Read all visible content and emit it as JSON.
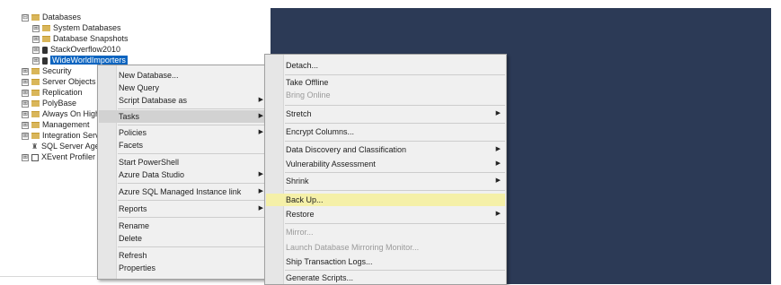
{
  "tree": {
    "items": [
      {
        "label": "Databases",
        "expander": "⊟",
        "icon": "folder"
      },
      {
        "label": "System Databases",
        "expander": "⊞",
        "icon": "folder"
      },
      {
        "label": "Database Snapshots",
        "expander": "⊞",
        "icon": "folder"
      },
      {
        "label": "StackOverflow2010",
        "expander": "⊞",
        "icon": "db"
      },
      {
        "label": "WideWorldImporters",
        "expander": "⊞",
        "icon": "db"
      },
      {
        "label": "Security",
        "expander": "⊞",
        "icon": "folder"
      },
      {
        "label": "Server Objects",
        "expander": "⊞",
        "icon": "folder"
      },
      {
        "label": "Replication",
        "expander": "⊞",
        "icon": "folder"
      },
      {
        "label": "PolyBase",
        "expander": "⊞",
        "icon": "folder"
      },
      {
        "label": "Always On High Availability",
        "expander": "⊞",
        "icon": "folder"
      },
      {
        "label": "Management",
        "expander": "⊞",
        "icon": "folder"
      },
      {
        "label": "Integration Services Catalogs",
        "expander": "⊞",
        "icon": "folder"
      },
      {
        "label": "SQL Server Agent",
        "expander": "",
        "icon": "agent"
      },
      {
        "label": "XEvent Profiler",
        "expander": "⊞",
        "icon": "xevent"
      }
    ]
  },
  "context_menu": {
    "items": [
      {
        "label": "New Database..."
      },
      {
        "label": "New Query"
      },
      {
        "label": "Script Database as",
        "arrow": "▶"
      },
      {
        "label": "Tasks",
        "arrow": "▶"
      },
      {
        "label": "Policies",
        "arrow": "▶"
      },
      {
        "label": "Facets"
      },
      {
        "label": "Start PowerShell"
      },
      {
        "label": "Azure Data Studio",
        "arrow": "▶"
      },
      {
        "label": "Azure SQL Managed Instance link",
        "arrow": "▶"
      },
      {
        "label": "Reports",
        "arrow": "▶"
      },
      {
        "label": "Rename"
      },
      {
        "label": "Delete"
      },
      {
        "label": "Refresh"
      },
      {
        "label": "Properties"
      }
    ]
  },
  "tasks_menu": {
    "items": [
      {
        "label": "Detach..."
      },
      {
        "label": "Take Offline"
      },
      {
        "label": "Bring Online"
      },
      {
        "label": "Stretch",
        "arrow": "▶"
      },
      {
        "label": "Encrypt Columns..."
      },
      {
        "label": "Data Discovery and Classification",
        "arrow": "▶"
      },
      {
        "label": "Vulnerability Assessment",
        "arrow": "▶"
      },
      {
        "label": "Shrink",
        "arrow": "▶"
      },
      {
        "label": "Back Up..."
      },
      {
        "label": "Restore",
        "arrow": "▶"
      },
      {
        "label": "Mirror..."
      },
      {
        "label": "Launch Database Mirroring Monitor..."
      },
      {
        "label": "Ship Transaction Logs..."
      },
      {
        "label": "Generate Scripts..."
      }
    ]
  },
  "colors": {
    "right_pane": "#2c3a56",
    "selection": "#0b64c0",
    "menu_bg": "#f0f0f0",
    "hover": "#f5f0a8"
  }
}
